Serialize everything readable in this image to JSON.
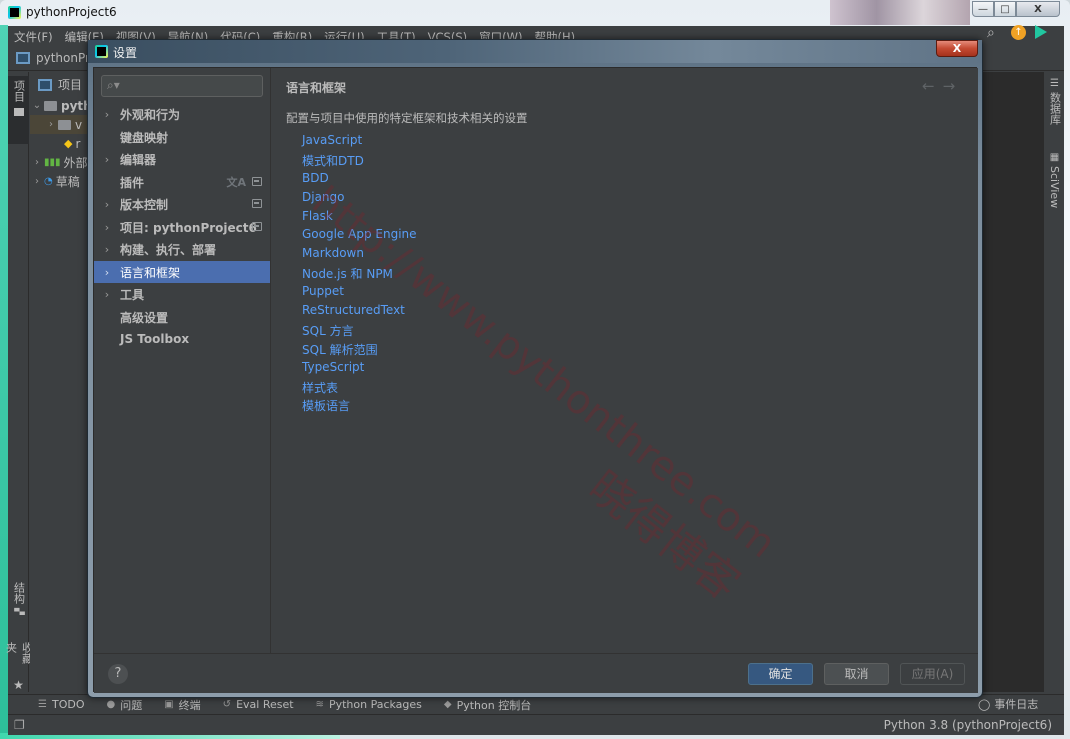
{
  "window": {
    "title": "pythonProject6",
    "controls": {
      "minimize": "—",
      "maximize": "□",
      "close": "X"
    }
  },
  "menubar": {
    "items": [
      "文件(F)",
      "编辑(E)",
      "视图(V)",
      "导航(N)",
      "代码(C)",
      "重构(R)",
      "运行(U)",
      "工具(T)",
      "VCS(S)",
      "窗口(W)",
      "帮助(H)"
    ]
  },
  "navbar": {
    "project": "pythonPro"
  },
  "left_strip": {
    "project_tab": "项目",
    "structure_tab": "结构",
    "favorites_tab": "收藏夹"
  },
  "right_strip": {
    "database_tab": "数据库",
    "sciview_tab": "SciView"
  },
  "project_panel": {
    "header": "项目",
    "tree": [
      {
        "label": "pyth",
        "expanded": true
      },
      {
        "label": "v",
        "expanded": false
      },
      {
        "label": "r"
      },
      {
        "label": "外部"
      },
      {
        "label": "草稿"
      }
    ]
  },
  "dialog": {
    "title": "设置",
    "close": "X",
    "search": {
      "value": "",
      "placeholder": ""
    },
    "sidebar": [
      {
        "label": "外观和行为",
        "chevron": true
      },
      {
        "label": "键盘映射",
        "chevron": false
      },
      {
        "label": "编辑器",
        "chevron": true
      },
      {
        "label": "插件",
        "chevron": false
      },
      {
        "label": "版本控制",
        "chevron": true
      },
      {
        "label": "项目: pythonProject6",
        "chevron": true
      },
      {
        "label": "构建、执行、部署",
        "chevron": true
      },
      {
        "label": "语言和框架",
        "chevron": true,
        "selected": true
      },
      {
        "label": "工具",
        "chevron": true
      },
      {
        "label": "高级设置",
        "chevron": false
      },
      {
        "label": "JS Toolbox",
        "chevron": false
      }
    ],
    "main": {
      "title": "语言和框架",
      "back": "←",
      "forward": "→",
      "description": "配置与项目中使用的特定框架和技术相关的设置",
      "links": [
        "JavaScript",
        "模式和DTD",
        "BDD",
        "Django",
        "Flask",
        "Google App Engine",
        "Markdown",
        "Node.js 和 NPM",
        "Puppet",
        "ReStructuredText",
        "SQL 方言",
        "SQL 解析范围",
        "TypeScript",
        "样式表",
        "模板语言"
      ]
    },
    "footer": {
      "help": "?",
      "ok": "确定",
      "cancel": "取消",
      "apply": "应用(A)"
    },
    "watermark": {
      "url": "http://www.pythonthree.com",
      "name": "晓得博客"
    }
  },
  "bottom_tabs": [
    "TODO",
    "问题",
    "终端",
    "Eval Reset",
    "Python Packages",
    "Python 控制台"
  ],
  "event_log": "事件日志",
  "status": {
    "interpreter": "Python 3.8 (pythonProject6)"
  },
  "colors": {
    "accent": "#4b6eaf",
    "link": "#589df6",
    "ok_button": "#365880",
    "background": "#3c3f41"
  }
}
